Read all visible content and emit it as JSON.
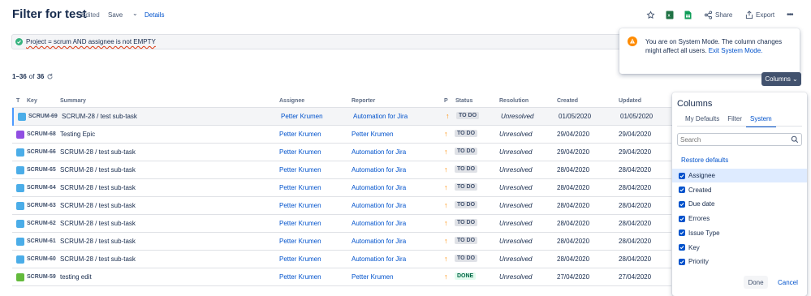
{
  "header": {
    "title": "Filter for test",
    "edited": "Edited",
    "save": "Save",
    "details": "Details",
    "actions": [
      {
        "name": "star-icon",
        "label": ""
      },
      {
        "name": "excel-icon",
        "label": ""
      },
      {
        "name": "sheets-icon",
        "label": ""
      },
      {
        "name": "share",
        "label": "Share"
      },
      {
        "name": "export",
        "label": "Export"
      },
      {
        "name": "more-icon",
        "label": "•••"
      }
    ]
  },
  "jql": {
    "query": "Project = scrum AND assignee is not EMPTY"
  },
  "toast": {
    "message": "You are on System Mode. The column changes might affect all users.",
    "link": "Exit System Mode."
  },
  "results": {
    "range": "1–36",
    "of": "of",
    "total": "36"
  },
  "columns_button": "Columns",
  "table": {
    "headers": {
      "t": "T",
      "key": "Key",
      "summary": "Summary",
      "assignee": "Assignee",
      "reporter": "Reporter",
      "p": "P",
      "status": "Status",
      "resolution": "Resolution",
      "created": "Created",
      "updated": "Updated"
    },
    "rows": [
      {
        "type": "subtask",
        "key": "SCRUM-69",
        "summary": "SCRUM-28 / test sub-task",
        "assignee": "Petter Krumen",
        "reporter": "Automation for Jira",
        "priority": "↑",
        "status": "TO DO",
        "resolution": "Unresolved",
        "created": "01/05/2020",
        "updated": "01/05/2020"
      },
      {
        "type": "epic",
        "key": "SCRUM-68",
        "summary": "Testing Epic",
        "assignee": "Petter Krumen",
        "reporter": "Petter Krumen",
        "priority": "↑",
        "status": "TO DO",
        "resolution": "Unresolved",
        "created": "29/04/2020",
        "updated": "29/04/2020"
      },
      {
        "type": "subtask",
        "key": "SCRUM-66",
        "summary": "SCRUM-28 / test sub-task",
        "assignee": "Petter Krumen",
        "reporter": "Automation for Jira",
        "priority": "↑",
        "status": "TO DO",
        "resolution": "Unresolved",
        "created": "29/04/2020",
        "updated": "29/04/2020"
      },
      {
        "type": "subtask",
        "key": "SCRUM-65",
        "summary": "SCRUM-28 / test sub-task",
        "assignee": "Petter Krumen",
        "reporter": "Automation for Jira",
        "priority": "↑",
        "status": "TO DO",
        "resolution": "Unresolved",
        "created": "28/04/2020",
        "updated": "28/04/2020"
      },
      {
        "type": "subtask",
        "key": "SCRUM-64",
        "summary": "SCRUM-28 / test sub-task",
        "assignee": "Petter Krumen",
        "reporter": "Automation for Jira",
        "priority": "↑",
        "status": "TO DO",
        "resolution": "Unresolved",
        "created": "28/04/2020",
        "updated": "28/04/2020"
      },
      {
        "type": "subtask",
        "key": "SCRUM-63",
        "summary": "SCRUM-28 / test sub-task",
        "assignee": "Petter Krumen",
        "reporter": "Automation for Jira",
        "priority": "↑",
        "status": "TO DO",
        "resolution": "Unresolved",
        "created": "28/04/2020",
        "updated": "28/04/2020"
      },
      {
        "type": "subtask",
        "key": "SCRUM-62",
        "summary": "SCRUM-28 / test sub-task",
        "assignee": "Petter Krumen",
        "reporter": "Automation for Jira",
        "priority": "↑",
        "status": "TO DO",
        "resolution": "Unresolved",
        "created": "28/04/2020",
        "updated": "28/04/2020"
      },
      {
        "type": "subtask",
        "key": "SCRUM-61",
        "summary": "SCRUM-28 / test sub-task",
        "assignee": "Petter Krumen",
        "reporter": "Automation for Jira",
        "priority": "↑",
        "status": "TO DO",
        "resolution": "Unresolved",
        "created": "28/04/2020",
        "updated": "28/04/2020"
      },
      {
        "type": "subtask",
        "key": "SCRUM-60",
        "summary": "SCRUM-28 / test sub-task",
        "assignee": "Petter Krumen",
        "reporter": "Automation for Jira",
        "priority": "↑",
        "status": "TO DO",
        "resolution": "Unresolved",
        "created": "28/04/2020",
        "updated": "28/04/2020"
      },
      {
        "type": "story",
        "key": "SCRUM-59",
        "summary": "testing edit",
        "assignee": "Petter Krumen",
        "reporter": "Petter Krumen",
        "priority": "↑",
        "status": "DONE",
        "resolution": "Unresolved",
        "created": "27/04/2020",
        "updated": "27/04/2020"
      }
    ]
  },
  "columns_panel": {
    "title": "Columns",
    "tabs": [
      "My Defaults",
      "Filter",
      "System"
    ],
    "active_tab": "System",
    "search_placeholder": "Search",
    "restore": "Restore defaults",
    "items": [
      "Assignee",
      "Created",
      "Due date",
      "Errores",
      "Issue Type",
      "Key",
      "Priority"
    ],
    "done": "Done",
    "cancel": "Cancel"
  },
  "colors": {
    "subtask": "#4bade8",
    "epic": "#904ee2",
    "story": "#63ba3c",
    "link": "#0052cc",
    "priority": "#ff8b00"
  }
}
